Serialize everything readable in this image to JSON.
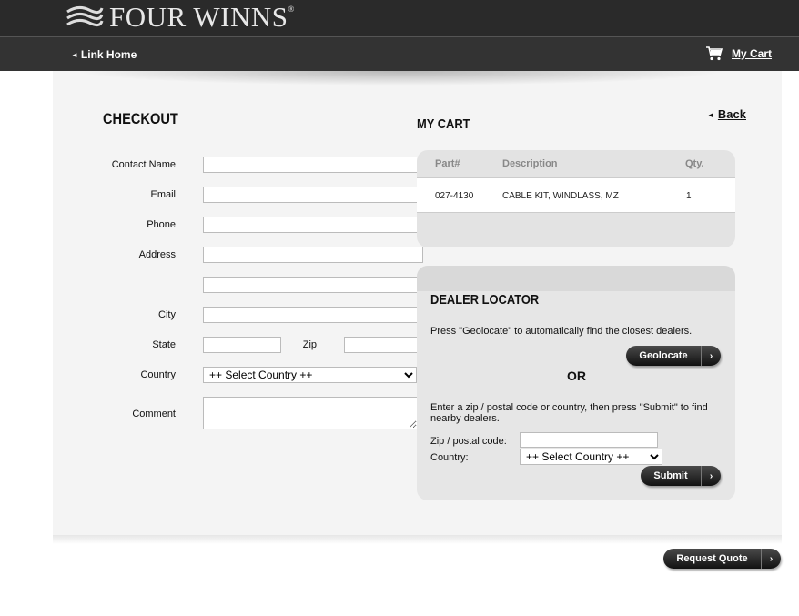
{
  "header": {
    "brand": "FOUR WINNS",
    "brand_mark": "®",
    "link_home": "Link Home",
    "my_cart": "My Cart"
  },
  "checkout": {
    "title": "CHECKOUT",
    "labels": {
      "contact_name": "Contact Name",
      "email": "Email",
      "phone": "Phone",
      "address": "Address",
      "city": "City",
      "state": "State",
      "zip": "Zip",
      "country": "Country",
      "comment": "Comment"
    },
    "values": {
      "contact_name": "",
      "email": "",
      "phone": "",
      "address1": "",
      "address2": "",
      "city": "",
      "state": "",
      "zip": "",
      "comment": ""
    },
    "country_selected": "++ Select Country ++"
  },
  "cart": {
    "title": "MY CART",
    "back": "Back",
    "columns": [
      "Part#",
      "Description",
      "Qty."
    ],
    "rows": [
      {
        "part": "027-4130",
        "description": "CABLE KIT, WINDLASS, MZ",
        "qty": "1"
      }
    ]
  },
  "dealer_locator": {
    "title": "DEALER LOCATOR",
    "geolocate_text": "Press \"Geolocate\" to automatically find the closest dealers.",
    "geolocate_button": "Geolocate",
    "or": "OR",
    "submit_text": "Enter a zip / postal code or country, then press \"Submit\" to find nearby dealers.",
    "zip_label": "Zip / postal code:",
    "zip_value": "",
    "country_label": "Country:",
    "country_selected": "++ Select Country ++",
    "submit_button": "Submit"
  },
  "footer": {
    "request_quote": "Request Quote"
  },
  "icons": {
    "arrow": "›",
    "back_triangle": "◄"
  }
}
